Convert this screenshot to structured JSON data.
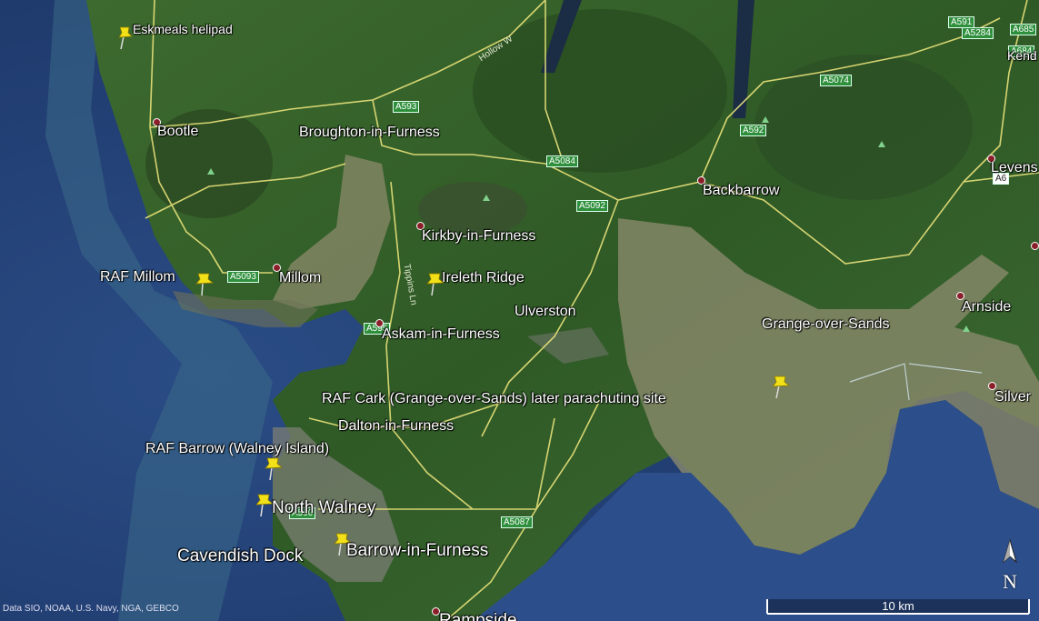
{
  "places": [
    {
      "id": "eskmeals-helipad",
      "label": "Eskmeals helipad"
    },
    {
      "id": "bootle",
      "label": "Bootle"
    },
    {
      "id": "broughton",
      "label": "Broughton-in-Furness"
    },
    {
      "id": "kirkby",
      "label": "Kirkby-in-Furness"
    },
    {
      "id": "raf-millom",
      "label": "RAF Millom"
    },
    {
      "id": "millom",
      "label": "Millom"
    },
    {
      "id": "ireleth",
      "label": "Ireleth Ridge"
    },
    {
      "id": "ulverston",
      "label": "Ulverston"
    },
    {
      "id": "askam",
      "label": "Askam-in-Furness"
    },
    {
      "id": "raf-cark",
      "label": "RAF Cark (Grange-over-Sands) later parachuting site"
    },
    {
      "id": "dalton",
      "label": "Dalton-in-Furness"
    },
    {
      "id": "raf-barrow",
      "label": "RAF Barrow (Walney Island)"
    },
    {
      "id": "north-walney",
      "label": "North Walney"
    },
    {
      "id": "cavendish",
      "label": "Cavendish Dock"
    },
    {
      "id": "barrow",
      "label": "Barrow-in-Furness"
    },
    {
      "id": "roose",
      "label": "Rampside"
    },
    {
      "id": "backbarrow",
      "label": "Backbarrow"
    },
    {
      "id": "grange",
      "label": "Grange-over-Sands"
    },
    {
      "id": "arnside",
      "label": "Arnside"
    },
    {
      "id": "levens",
      "label": "Levens"
    },
    {
      "id": "silverdale",
      "label": "Silver"
    },
    {
      "id": "kendal",
      "label": "Kend"
    }
  ],
  "roads": {
    "a593": "A593",
    "a5084": "A5084",
    "a5092": "A5092",
    "a592": "A592",
    "a5074": "A5074",
    "a591": "A591",
    "a5284": "A5284",
    "a685": "A685",
    "a6": "A6",
    "a5093": "A5093",
    "a595": "A595",
    "a590": "A590",
    "a5087": "A5087",
    "a684": "A684"
  },
  "road_names": {
    "hollow": "Hollow W",
    "tippins": "Tippins Ln"
  },
  "attribution": "Data SIO, NOAA, U.S. Navy, NGA, GEBCO",
  "scale": "10 km",
  "north": "N"
}
